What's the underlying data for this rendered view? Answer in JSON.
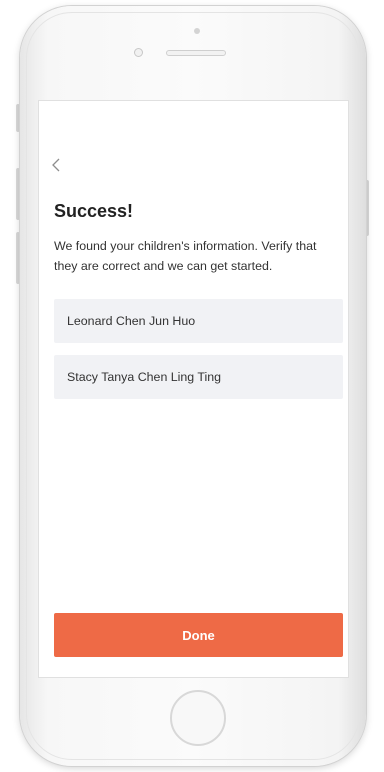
{
  "screen": {
    "back_icon": "chevron-left-icon",
    "title": "Success!",
    "message": "We found your children's information. Verify that they are correct and we can get started.",
    "children": [
      {
        "name": "Leonard Chen Jun Huo"
      },
      {
        "name": "Stacy Tanya Chen Ling Ting"
      }
    ],
    "done_label": "Done"
  },
  "colors": {
    "accent": "#ee6a46",
    "list_item_bg": "#f1f2f5",
    "text_primary": "#222222",
    "text_secondary": "#333333"
  }
}
